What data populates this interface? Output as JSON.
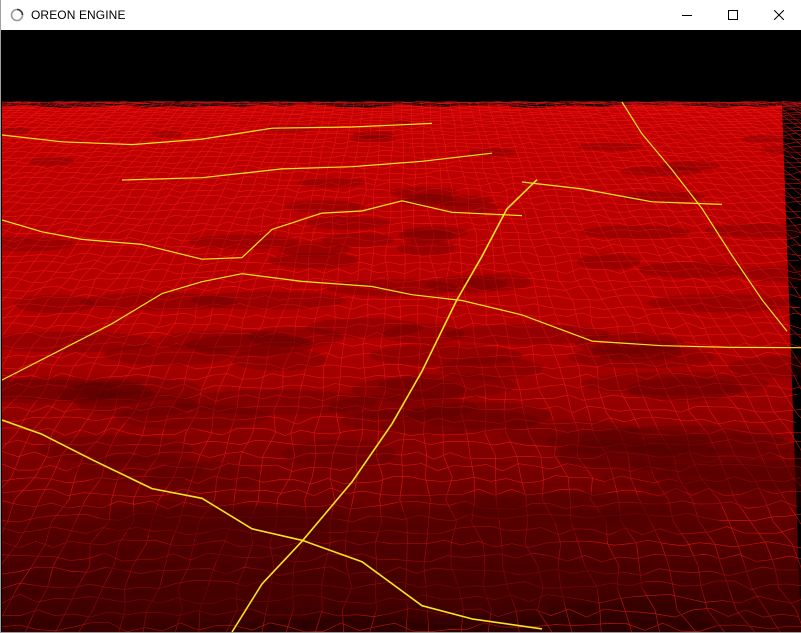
{
  "window": {
    "title": "OREON ENGINE",
    "icon": "loading-ring-icon",
    "controls": {
      "minimize_icon": "minimize-icon",
      "maximize_icon": "maximize-icon",
      "close_icon": "close-icon"
    }
  },
  "scene": {
    "render_mode": "wireframe-terrain",
    "sky_color": "#000000",
    "terrain_fill_color": "#b00000",
    "wire_color": "#ff1a1a",
    "seam_color": "#f5e61e"
  }
}
